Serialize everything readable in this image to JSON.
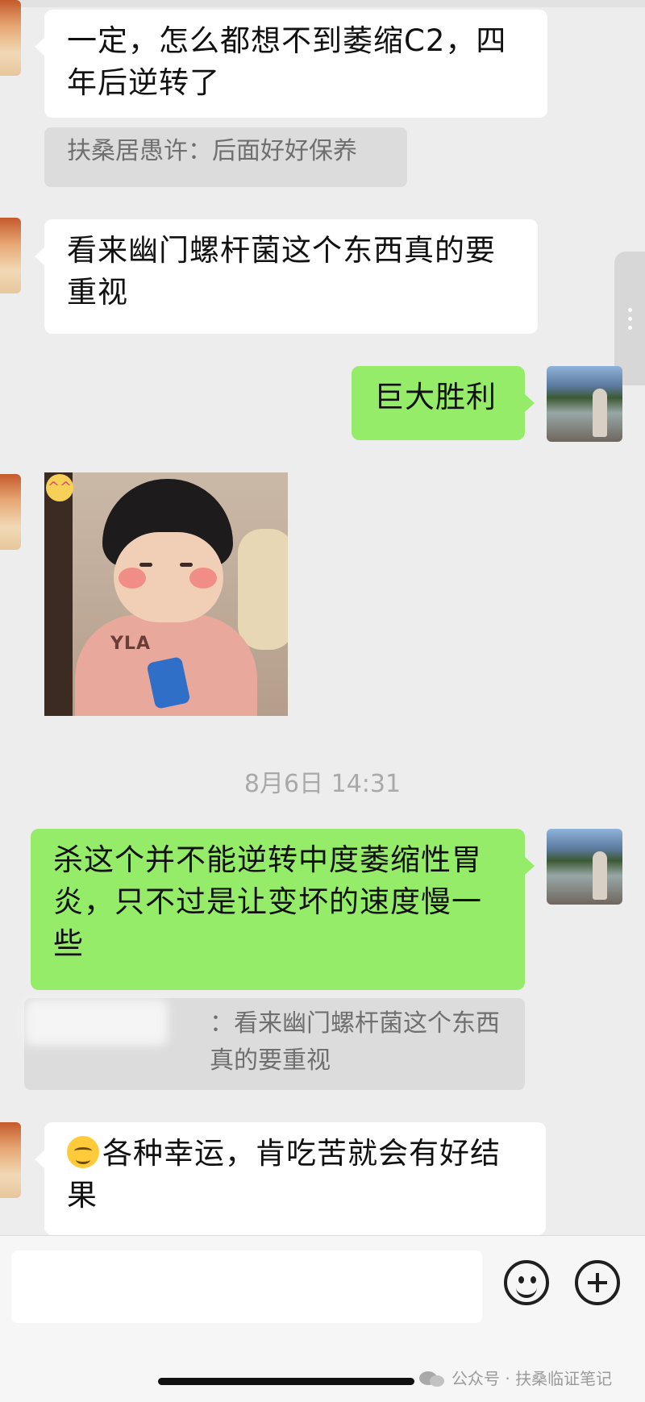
{
  "messages": [
    {
      "side": "in",
      "text": "一定，怎么都想不到萎缩C2，四年后逆转了"
    },
    {
      "side": "quote",
      "text": "扶桑居愚许：后面好好保养"
    },
    {
      "side": "in",
      "text": "看来幽门螺杆菌这个东西真的要重视"
    },
    {
      "side": "out",
      "text": "巨大胜利"
    },
    {
      "side": "in",
      "type": "sticker",
      "sticker_text": "YLA",
      "badge": "^^"
    },
    {
      "side": "time",
      "text": "8月6日 14:31"
    },
    {
      "side": "out",
      "text": "杀这个并不能逆转中度萎缩性胃炎，只不过是让变坏的速度慢一些"
    },
    {
      "side": "quote",
      "text": "：看来幽门螺杆菌这个东西真的要重视"
    },
    {
      "side": "in",
      "emoji": "relieved-face-icon",
      "text": "各种幸运，肯吃苦就会有好结果"
    }
  ],
  "input": {
    "placeholder": ""
  },
  "watermark": {
    "text": "公众号 · 扶桑临证笔记"
  },
  "colors": {
    "background": "#ededed",
    "incoming": "#ffffff",
    "outgoing": "#95ec69",
    "quote": "#dcdcdc"
  }
}
